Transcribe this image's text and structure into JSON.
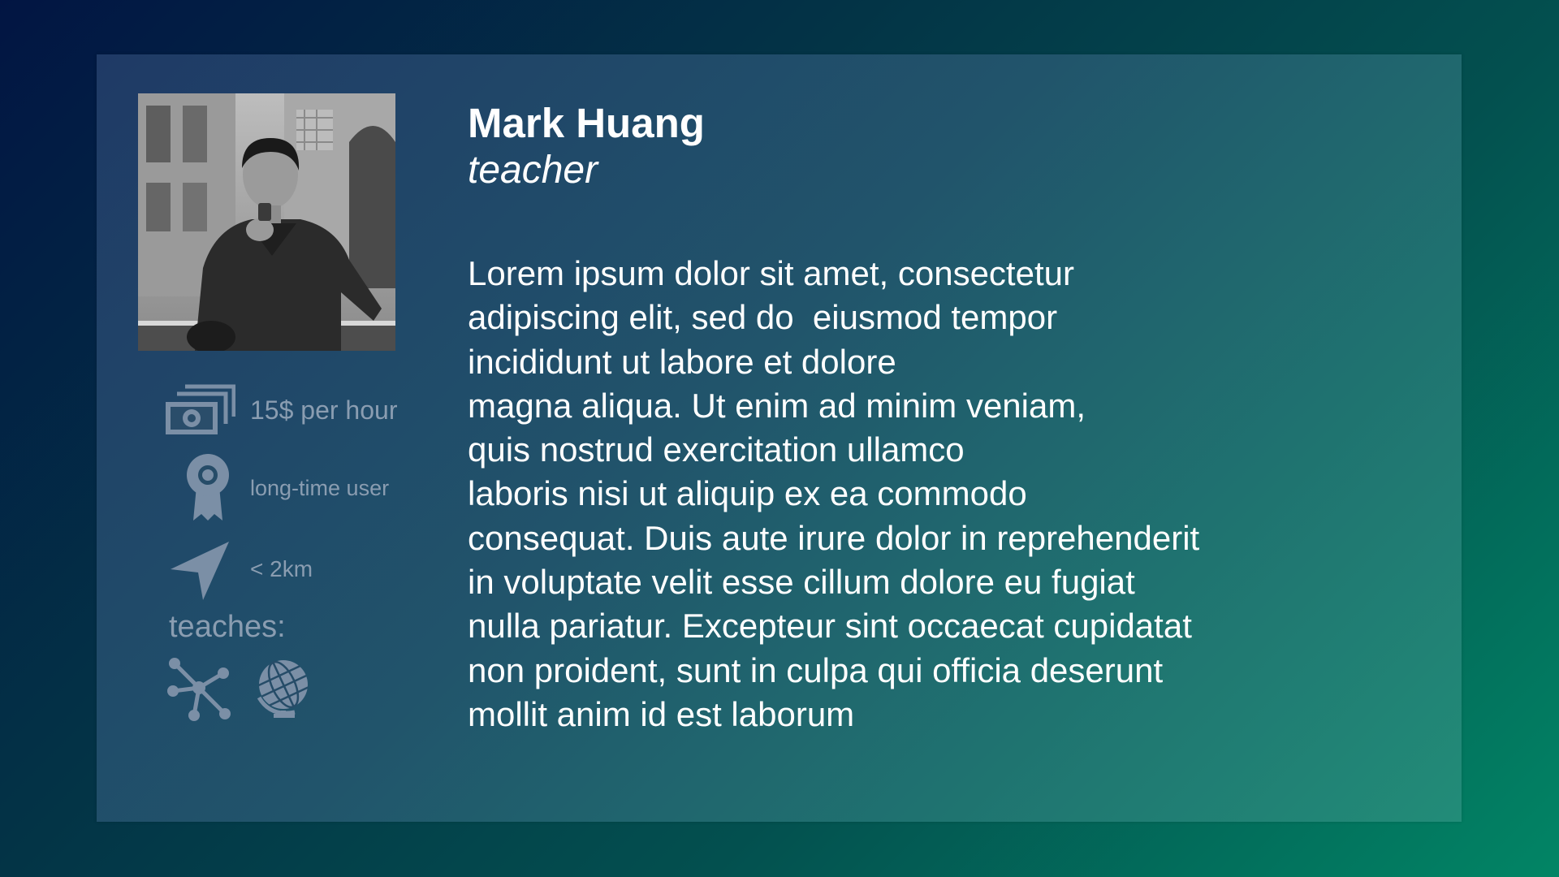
{
  "profile": {
    "name": "Mark Huang",
    "role": "teacher",
    "photo": {
      "icon": "profile-photo"
    }
  },
  "stats": {
    "price": {
      "text": "15$ per hour",
      "icon": "money-bills-icon"
    },
    "badge": {
      "text": "long-time user",
      "icon": "award-ribbon-icon"
    },
    "distance": {
      "text": "< 2km",
      "icon": "location-arrow-icon"
    }
  },
  "teaches": {
    "label": "teaches:",
    "subjects": [
      {
        "icon": "molecule-icon"
      },
      {
        "icon": "globe-icon"
      }
    ]
  },
  "bio": {
    "lines": [
      "Lorem ipsum dolor sit amet, consectetur",
      "adipiscing elit, sed do  eiusmod tempor",
      "incididunt ut labore et dolore",
      "magna aliqua. Ut enim ad minim veniam,",
      "quis nostrud exercitation ullamco",
      "laboris nisi ut aliquip ex ea commodo",
      "consequat. Duis aute irure dolor in reprehenderit",
      "in voluptate velit esse cillum dolore eu fugiat",
      "nulla pariatur. Excepteur sint occaecat cupidatat",
      "non proident, sunt in culpa qui officia deserunt",
      "mollit anim id est laborum"
    ]
  },
  "colors": {
    "muted_text": "#8a9db1",
    "icon": "#7b8fa6",
    "text": "#ffffff"
  }
}
